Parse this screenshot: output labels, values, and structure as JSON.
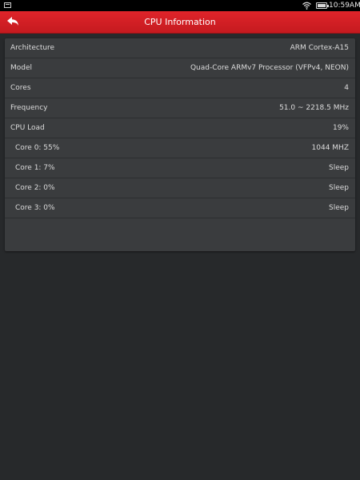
{
  "status_bar": {
    "time": "10:59AM"
  },
  "header": {
    "title": "CPU Information",
    "background_color": "#d62026"
  },
  "info_rows": [
    {
      "label": "Architecture",
      "value": "ARM Cortex-A15"
    },
    {
      "label": "Model",
      "value": "Quad-Core ARMv7 Processor (VFPv4, NEON)"
    },
    {
      "label": "Cores",
      "value": "4"
    },
    {
      "label": "Frequency",
      "value": "51.0 ~ 2218.5 MHz"
    },
    {
      "label": "CPU Load",
      "value": "19%"
    }
  ],
  "core_rows": [
    {
      "label": "Core 0: 55%",
      "value": "1044 MHZ"
    },
    {
      "label": "Core 1: 7%",
      "value": "Sleep"
    },
    {
      "label": "Core 2: 0%",
      "value": "Sleep"
    },
    {
      "label": "Core 3: 0%",
      "value": "Sleep"
    }
  ],
  "icons": {
    "back": "back-arrow-icon",
    "wifi": "wifi-icon",
    "battery": "battery-icon",
    "notification": "notification-icon"
  }
}
